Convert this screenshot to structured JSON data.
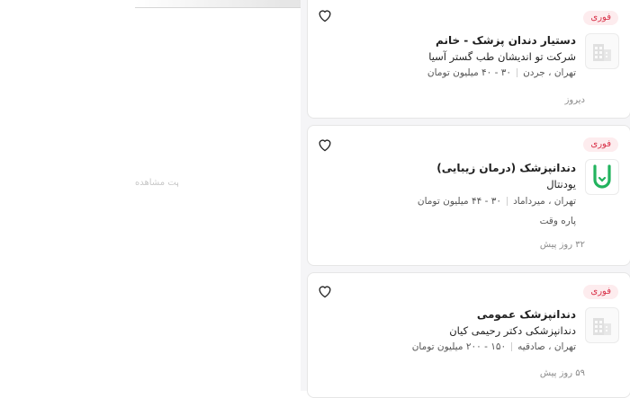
{
  "left": {
    "hint": "جهت مشاهده"
  },
  "jobs": [
    {
      "badge": "فوری",
      "title": "دستیار دندان پزشک - خانم",
      "company": "شرکت تو اندیشان طب گستر آسیا",
      "location": "تهران ، جردن",
      "salary": "۳۰ - ۴۰ میلیون تومان",
      "extra": "",
      "date": "دیروز",
      "logo_icon": "building-icon"
    },
    {
      "badge": "فوری",
      "title": "دندانپزشک (درمان زیبایی)",
      "company": "یودنتال",
      "location": "تهران ، میرداماد",
      "salary": "۳۰ - ۴۴ میلیون تومان",
      "extra": "پاره وقت",
      "date": "۳۲ روز پیش",
      "logo_icon": "tooth-logo-icon"
    },
    {
      "badge": "فوری",
      "title": "دندانپزشک عمومی",
      "company": "دندانپزشکی دکتر رحیمی کیان",
      "location": "تهران ، صادقیه",
      "salary": "۱۵۰ - ۲۰۰ میلیون تومان",
      "extra": "",
      "date": "۵۹ روز پیش",
      "logo_icon": "building-icon"
    }
  ],
  "colors": {
    "badge_bg": "#fdecee",
    "badge_text": "#d9334a",
    "logo_green": "#22b35e"
  }
}
